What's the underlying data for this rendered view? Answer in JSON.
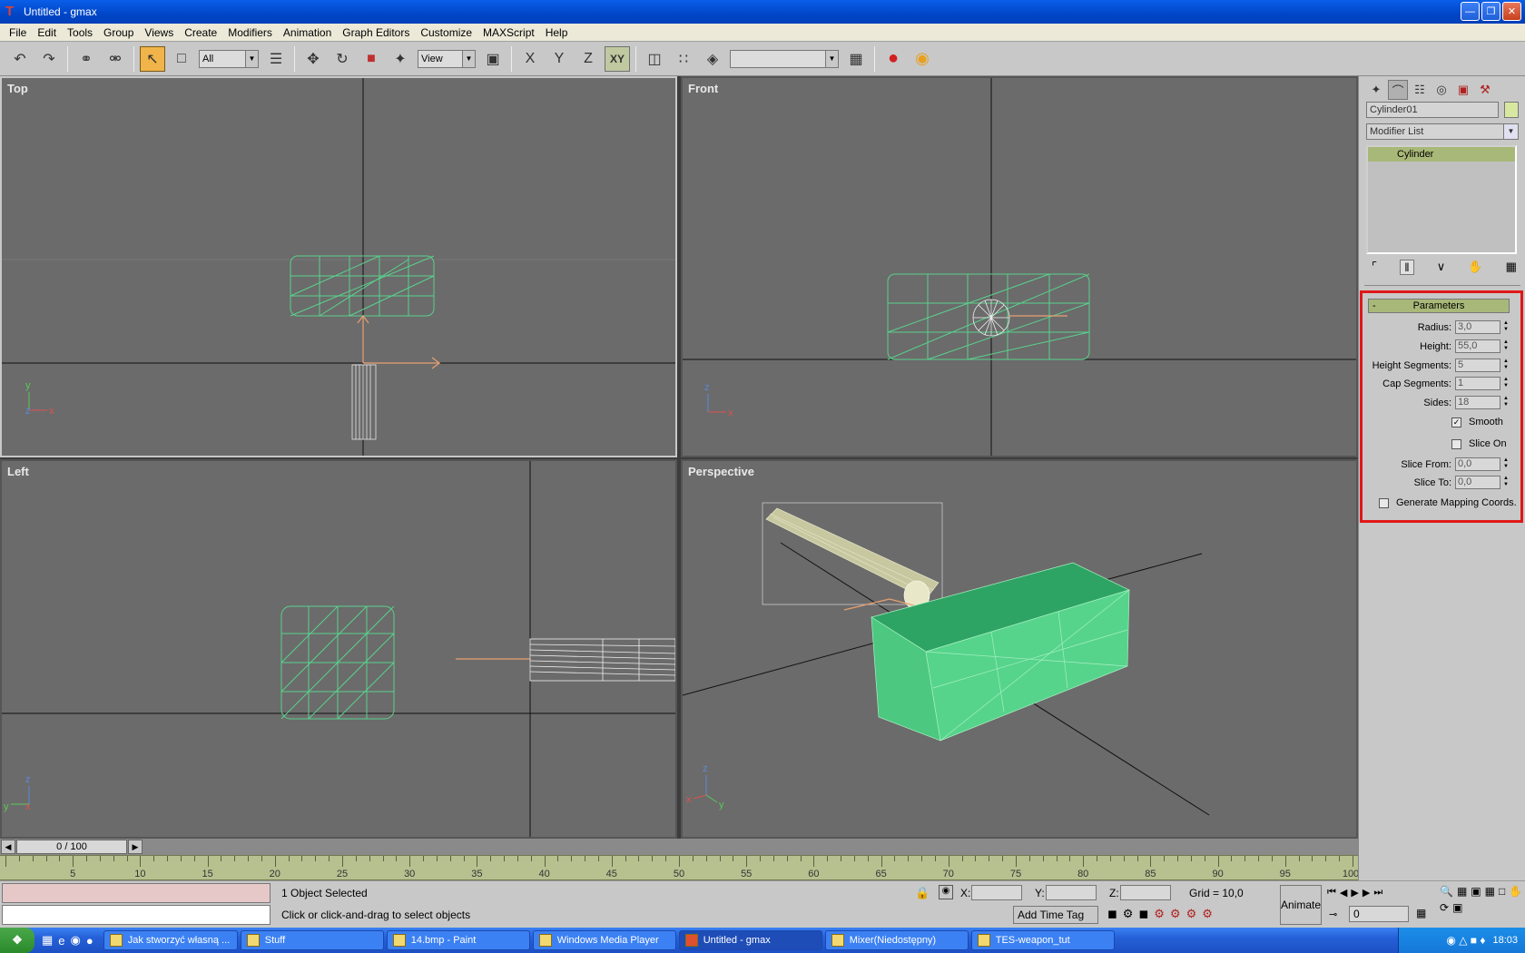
{
  "window": {
    "title": "Untitled - gmax",
    "min": "0",
    "max": "1",
    "close": "r"
  },
  "menu": [
    "File",
    "Edit",
    "Tools",
    "Group",
    "Views",
    "Create",
    "Modifiers",
    "Animation",
    "Graph Editors",
    "Customize",
    "MAXScript",
    "Help"
  ],
  "toolbar": {
    "selection_filter": "All",
    "ref_coord": "View",
    "axis_x": "X",
    "axis_y": "Y",
    "axis_z": "Z",
    "axis_xy": "XY",
    "named_selection": ""
  },
  "viewports": {
    "top": "Top",
    "front": "Front",
    "left": "Left",
    "perspective": "Perspective",
    "axis_y": "y",
    "axis_x": "x",
    "axis_z": "z"
  },
  "timeline": {
    "position": "0 / 100",
    "ticks": [
      "5",
      "10",
      "15",
      "20",
      "25",
      "30",
      "35",
      "40",
      "45",
      "50",
      "55",
      "60",
      "65",
      "70",
      "75",
      "80",
      "85",
      "90",
      "95",
      "100"
    ]
  },
  "status": {
    "selected": "1 Object Selected",
    "prompt": "Click or click-and-drag to select objects",
    "x_label": "X:",
    "y_label": "Y:",
    "z_label": "Z:",
    "x_value": "",
    "y_value": "",
    "z_value": "",
    "grid": "Grid = 10,0",
    "add_time_tag": "Add Time Tag",
    "animate": "Animate",
    "frame": "0"
  },
  "command_panel": {
    "object_name": "Cylinder01",
    "object_color": "#d8e8a0",
    "modifier_list": "Modifier List",
    "stack_item": "Cylinder",
    "rollout_title": "Parameters",
    "rollout_toggle": "-",
    "params": [
      {
        "label": "Radius:",
        "value": "3,0"
      },
      {
        "label": "Height:",
        "value": "55,0"
      },
      {
        "label": "Height Segments:",
        "value": "5"
      },
      {
        "label": "Cap Segments:",
        "value": "1"
      },
      {
        "label": "Sides:",
        "value": "18"
      }
    ],
    "smooth_label": "Smooth",
    "smooth_checked": "✓",
    "slice_on_label": "Slice On",
    "slice_params": [
      {
        "label": "Slice From:",
        "value": "0,0"
      },
      {
        "label": "Slice To:",
        "value": "0,0"
      }
    ],
    "mapping_label": "Generate Mapping Coords."
  },
  "taskbar": {
    "tasks": [
      {
        "label": "Jak stworzyć własną ..."
      },
      {
        "label": "Stuff"
      },
      {
        "label": "14.bmp - Paint"
      },
      {
        "label": "Windows Media Player"
      },
      {
        "label": "Untitled - gmax"
      },
      {
        "label": "Mixer(Niedostępny)"
      },
      {
        "label": "TES-weapon_tut"
      }
    ],
    "clock": "18:03"
  },
  "colors": {
    "highlight": "#e01818",
    "wire": "#5ad28c",
    "viewport_bg": "#6b6b6b"
  }
}
